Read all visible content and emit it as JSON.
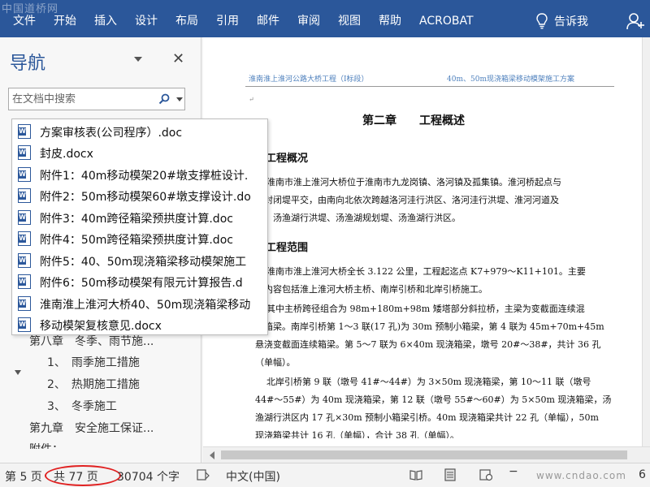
{
  "ribbon": {
    "watermark": "中国道桥网",
    "tabs": [
      "文件",
      "开始",
      "插入",
      "设计",
      "布局",
      "引用",
      "邮件",
      "审阅",
      "视图",
      "帮助",
      "ACROBAT"
    ],
    "tell_me": "告诉我"
  },
  "nav": {
    "title": "导航",
    "search_placeholder": "在文档中搜索",
    "headings": [
      "第八章　冬季、雨节施...",
      "1、　雨季施工措施",
      "2、　热期施工措施",
      "3、　冬季施工",
      "第九章　安全施工保证...",
      "附件："
    ]
  },
  "files": [
    "方案审核表(公司程序）.doc",
    "封皮.docx",
    "附件1：40m移动模架20#墩支撑桩设计.",
    "附件2：50m移动模架60#墩支撑设计.do",
    "附件3：40m跨径箱梁预拱度计算.doc",
    "附件4：50m跨径箱梁预拱度计算.doc",
    "附件5：40、50m现浇箱梁移动模架施工",
    "附件6：50m移动模架有限元计算报告.d",
    "淮南淮上淮河大桥40、50m现浇箱梁移动",
    "移动模架复核意见.docx"
  ],
  "document": {
    "header_left": "淮南淮上淮河公路大桥工程（I标段）",
    "header_right": "40m、50m现浇箱梁移动模架施工方案",
    "chapter": "第二章　　工程概述",
    "sec1": "、工程概况",
    "p1": [
      "淮南市淮上淮河大桥位于淮南市九龙岗镇、洛河镇及孤集镇。淮河桥起点与",
      "河封闭堤平交，由南向北依次跨越洛河洼行洪区、洛河洼行洪堤、淮河河道及",
      "堤、汤渔湖行洪堤、汤渔湖规划堤、汤渔湖行洪区。"
    ],
    "sec2": "、工程范围",
    "p2": [
      "淮南市淮上淮河大桥全长 3.122 公里，工程起迄点 K7+979～K11+101。主要",
      "程内容包括淮上淮河大桥主桥、南岸引桥和北岸引桥施工。"
    ],
    "p3": [
      "其中主桥跨径组合为 98m+180m+98m 矮塔部分斜拉桥，主梁为变截面连续混",
      "土箱梁。南岸引桥第 1～3 联(17 孔)为 30m 预制小箱梁，第 4 联为 45m+70m+45m",
      "悬浇变截面连续箱梁。第 5～7 联为 6×40m 现浇箱梁，墩号 20#～38#，共计 36 孔",
      "（单幅）。"
    ],
    "p4": [
      "北岸引桥第 9 联（墩号 41#～44#）为 3×50m 现浇箱梁，第 10～11 联（墩号",
      "44#～55#）为 40m 现浇箱梁，第 12 联（墩号 55#～60#）为 5×50m 现浇箱梁，汤",
      "渔湖行洪区内 17 孔×30m 预制小箱梁引桥。40m 现浇箱梁共计 22 孔（单幅），50m",
      "现浇箱梁共计 16 孔（单幅），合计 38 孔（单幅）。"
    ]
  },
  "status": {
    "page": "第 5 页",
    "total": "共 77 页",
    "words": "30704 个字",
    "lang": "中文(中国)",
    "watermark": "www.cndao.com",
    "zoom": "6"
  },
  "colors": {
    "ribbon": "#2b579a",
    "highlight_circle": "#e02020"
  }
}
